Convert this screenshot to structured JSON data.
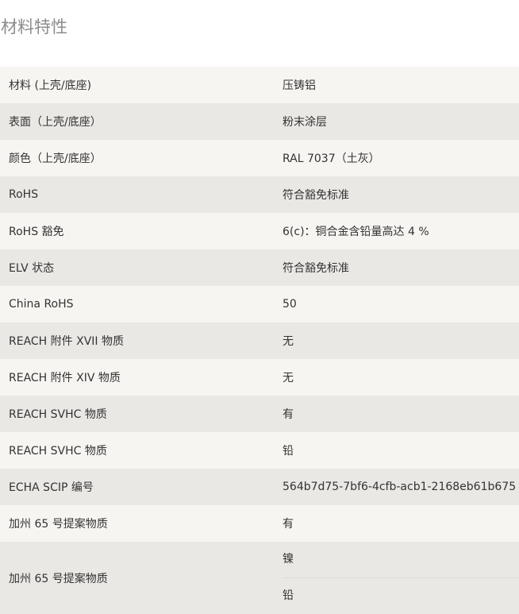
{
  "page": {
    "title": "材料特性"
  },
  "table": {
    "rows": [
      {
        "label": "材料 (上壳/底座)",
        "value": "压铸铝"
      },
      {
        "label": "表面（上壳/底座）",
        "value": "粉末涂层"
      },
      {
        "label": "颜色（上壳/底座）",
        "value": "RAL 7037（土灰）"
      },
      {
        "label": "RoHS",
        "value": "符合豁免标准"
      },
      {
        "label": "RoHS 豁免",
        "value": "6(c)：铜合金含铅量高达 4 %"
      },
      {
        "label": "ELV 状态",
        "value": "符合豁免标准"
      },
      {
        "label": "China RoHS",
        "value": "50"
      },
      {
        "label": "REACH 附件 XVII 物质",
        "value": "无"
      },
      {
        "label": "REACH 附件 XIV 物质",
        "value": "无"
      },
      {
        "label": "REACH SVHC 物质",
        "value": "有"
      },
      {
        "label": "REACH SVHC 物质",
        "value": "铅"
      },
      {
        "label": "ECHA SCIP 编号",
        "value": "564b7d75-7bf6-4cfb-acb1-2168eb61b675"
      },
      {
        "label": "加州 65 号提案物质",
        "value": "有"
      }
    ],
    "last_row": {
      "label": "加州 65 号提案物质",
      "values": [
        "镍",
        "铅"
      ]
    }
  }
}
